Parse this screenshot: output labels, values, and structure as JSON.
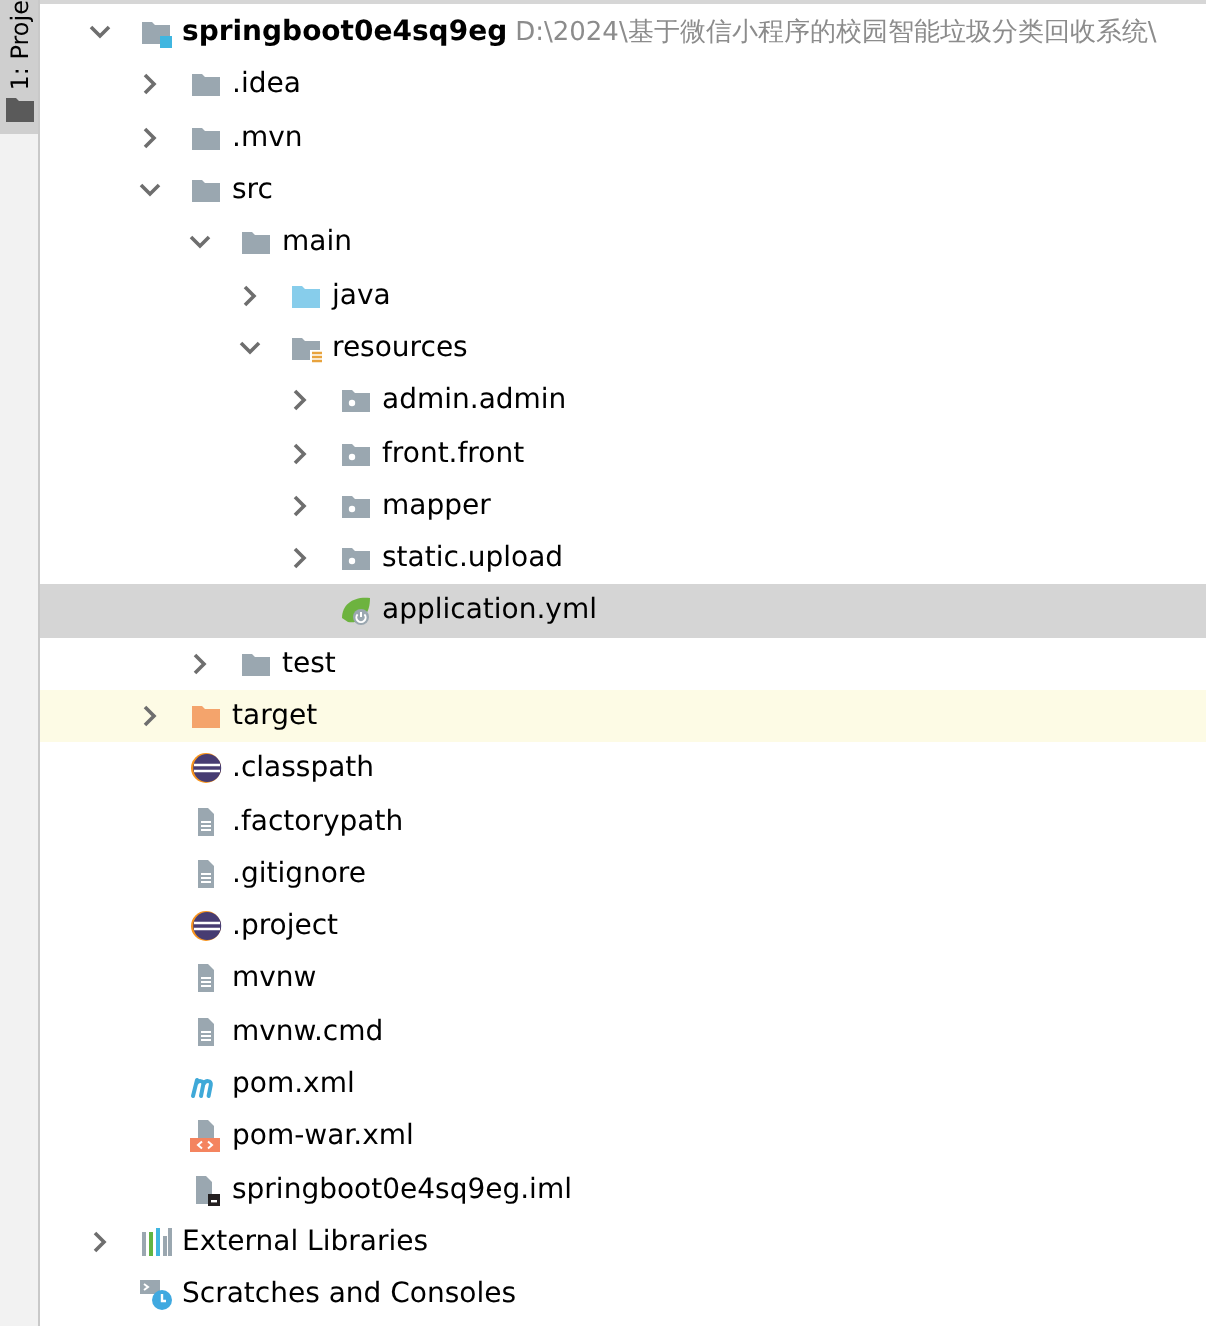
{
  "side_tab": {
    "label": "1: Proje",
    "selected": true
  },
  "tree": [
    {
      "label": "springboot0e4sq9eg",
      "path": "D:\\2024\\基于微信小程序的校园智能垃圾分类回收系统\\",
      "kind": "module",
      "expanded": true,
      "selected": false,
      "children": [
        {
          "label": ".idea",
          "kind": "folder",
          "expanded": false,
          "selected": false
        },
        {
          "label": ".mvn",
          "kind": "folder",
          "expanded": false,
          "selected": false
        },
        {
          "label": "src",
          "kind": "folder",
          "expanded": true,
          "selected": false,
          "children": [
            {
              "label": "main",
              "kind": "folder",
              "expanded": true,
              "selected": false,
              "children": [
                {
                  "label": "java",
                  "kind": "source-folder",
                  "expanded": false,
                  "selected": false
                },
                {
                  "label": "resources",
                  "kind": "resources-folder",
                  "expanded": true,
                  "selected": false,
                  "children": [
                    {
                      "label": "admin.admin",
                      "kind": "package",
                      "expanded": false,
                      "selected": false
                    },
                    {
                      "label": "front.front",
                      "kind": "package",
                      "expanded": false,
                      "selected": false
                    },
                    {
                      "label": "mapper",
                      "kind": "package",
                      "expanded": false,
                      "selected": false
                    },
                    {
                      "label": "static.upload",
                      "kind": "package",
                      "expanded": false,
                      "selected": false
                    },
                    {
                      "label": "application.yml",
                      "kind": "spring-config",
                      "selected": true
                    }
                  ]
                }
              ]
            },
            {
              "label": "test",
              "kind": "folder",
              "expanded": false,
              "selected": false
            }
          ]
        },
        {
          "label": "target",
          "kind": "excluded-folder",
          "expanded": false,
          "selected": false
        },
        {
          "label": ".classpath",
          "kind": "eclipse",
          "selected": false
        },
        {
          "label": ".factorypath",
          "kind": "text",
          "selected": false
        },
        {
          "label": ".gitignore",
          "kind": "text",
          "selected": false
        },
        {
          "label": ".project",
          "kind": "eclipse",
          "selected": false
        },
        {
          "label": "mvnw",
          "kind": "text",
          "selected": false
        },
        {
          "label": "mvnw.cmd",
          "kind": "text",
          "selected": false
        },
        {
          "label": "pom.xml",
          "kind": "maven",
          "selected": false
        },
        {
          "label": "pom-war.xml",
          "kind": "xml",
          "selected": false
        },
        {
          "label": "springboot0e4sq9eg.iml",
          "kind": "iml",
          "selected": false
        }
      ]
    },
    {
      "label": "External Libraries",
      "kind": "libraries",
      "expanded": false,
      "selected": false
    },
    {
      "label": "Scratches and Consoles",
      "kind": "scratches",
      "selected": false
    }
  ]
}
